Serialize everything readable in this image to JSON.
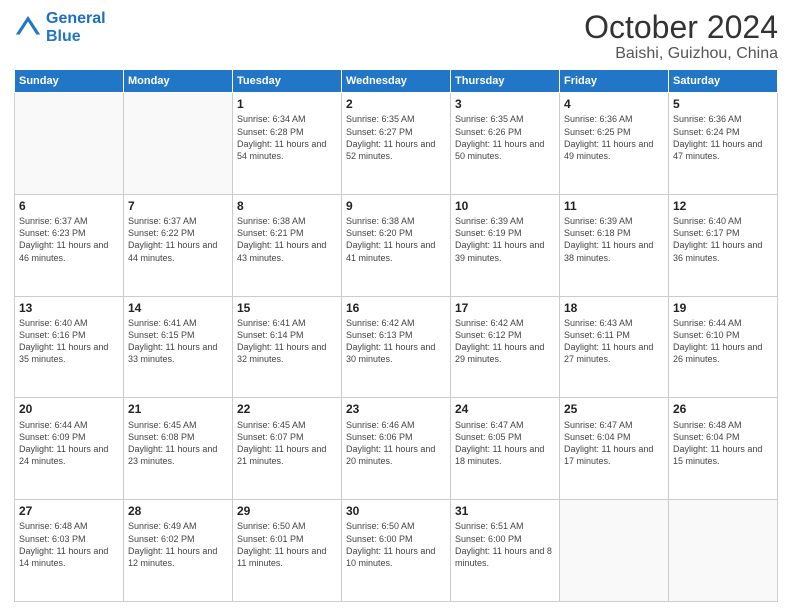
{
  "header": {
    "logo_line1": "General",
    "logo_line2": "Blue",
    "month_title": "October 2024",
    "location": "Baishi, Guizhou, China"
  },
  "weekdays": [
    "Sunday",
    "Monday",
    "Tuesday",
    "Wednesday",
    "Thursday",
    "Friday",
    "Saturday"
  ],
  "weeks": [
    [
      {
        "day": "",
        "info": ""
      },
      {
        "day": "",
        "info": ""
      },
      {
        "day": "1",
        "info": "Sunrise: 6:34 AM\nSunset: 6:28 PM\nDaylight: 11 hours and 54 minutes."
      },
      {
        "day": "2",
        "info": "Sunrise: 6:35 AM\nSunset: 6:27 PM\nDaylight: 11 hours and 52 minutes."
      },
      {
        "day": "3",
        "info": "Sunrise: 6:35 AM\nSunset: 6:26 PM\nDaylight: 11 hours and 50 minutes."
      },
      {
        "day": "4",
        "info": "Sunrise: 6:36 AM\nSunset: 6:25 PM\nDaylight: 11 hours and 49 minutes."
      },
      {
        "day": "5",
        "info": "Sunrise: 6:36 AM\nSunset: 6:24 PM\nDaylight: 11 hours and 47 minutes."
      }
    ],
    [
      {
        "day": "6",
        "info": "Sunrise: 6:37 AM\nSunset: 6:23 PM\nDaylight: 11 hours and 46 minutes."
      },
      {
        "day": "7",
        "info": "Sunrise: 6:37 AM\nSunset: 6:22 PM\nDaylight: 11 hours and 44 minutes."
      },
      {
        "day": "8",
        "info": "Sunrise: 6:38 AM\nSunset: 6:21 PM\nDaylight: 11 hours and 43 minutes."
      },
      {
        "day": "9",
        "info": "Sunrise: 6:38 AM\nSunset: 6:20 PM\nDaylight: 11 hours and 41 minutes."
      },
      {
        "day": "10",
        "info": "Sunrise: 6:39 AM\nSunset: 6:19 PM\nDaylight: 11 hours and 39 minutes."
      },
      {
        "day": "11",
        "info": "Sunrise: 6:39 AM\nSunset: 6:18 PM\nDaylight: 11 hours and 38 minutes."
      },
      {
        "day": "12",
        "info": "Sunrise: 6:40 AM\nSunset: 6:17 PM\nDaylight: 11 hours and 36 minutes."
      }
    ],
    [
      {
        "day": "13",
        "info": "Sunrise: 6:40 AM\nSunset: 6:16 PM\nDaylight: 11 hours and 35 minutes."
      },
      {
        "day": "14",
        "info": "Sunrise: 6:41 AM\nSunset: 6:15 PM\nDaylight: 11 hours and 33 minutes."
      },
      {
        "day": "15",
        "info": "Sunrise: 6:41 AM\nSunset: 6:14 PM\nDaylight: 11 hours and 32 minutes."
      },
      {
        "day": "16",
        "info": "Sunrise: 6:42 AM\nSunset: 6:13 PM\nDaylight: 11 hours and 30 minutes."
      },
      {
        "day": "17",
        "info": "Sunrise: 6:42 AM\nSunset: 6:12 PM\nDaylight: 11 hours and 29 minutes."
      },
      {
        "day": "18",
        "info": "Sunrise: 6:43 AM\nSunset: 6:11 PM\nDaylight: 11 hours and 27 minutes."
      },
      {
        "day": "19",
        "info": "Sunrise: 6:44 AM\nSunset: 6:10 PM\nDaylight: 11 hours and 26 minutes."
      }
    ],
    [
      {
        "day": "20",
        "info": "Sunrise: 6:44 AM\nSunset: 6:09 PM\nDaylight: 11 hours and 24 minutes."
      },
      {
        "day": "21",
        "info": "Sunrise: 6:45 AM\nSunset: 6:08 PM\nDaylight: 11 hours and 23 minutes."
      },
      {
        "day": "22",
        "info": "Sunrise: 6:45 AM\nSunset: 6:07 PM\nDaylight: 11 hours and 21 minutes."
      },
      {
        "day": "23",
        "info": "Sunrise: 6:46 AM\nSunset: 6:06 PM\nDaylight: 11 hours and 20 minutes."
      },
      {
        "day": "24",
        "info": "Sunrise: 6:47 AM\nSunset: 6:05 PM\nDaylight: 11 hours and 18 minutes."
      },
      {
        "day": "25",
        "info": "Sunrise: 6:47 AM\nSunset: 6:04 PM\nDaylight: 11 hours and 17 minutes."
      },
      {
        "day": "26",
        "info": "Sunrise: 6:48 AM\nSunset: 6:04 PM\nDaylight: 11 hours and 15 minutes."
      }
    ],
    [
      {
        "day": "27",
        "info": "Sunrise: 6:48 AM\nSunset: 6:03 PM\nDaylight: 11 hours and 14 minutes."
      },
      {
        "day": "28",
        "info": "Sunrise: 6:49 AM\nSunset: 6:02 PM\nDaylight: 11 hours and 12 minutes."
      },
      {
        "day": "29",
        "info": "Sunrise: 6:50 AM\nSunset: 6:01 PM\nDaylight: 11 hours and 11 minutes."
      },
      {
        "day": "30",
        "info": "Sunrise: 6:50 AM\nSunset: 6:00 PM\nDaylight: 11 hours and 10 minutes."
      },
      {
        "day": "31",
        "info": "Sunrise: 6:51 AM\nSunset: 6:00 PM\nDaylight: 11 hours and 8 minutes."
      },
      {
        "day": "",
        "info": ""
      },
      {
        "day": "",
        "info": ""
      }
    ]
  ]
}
